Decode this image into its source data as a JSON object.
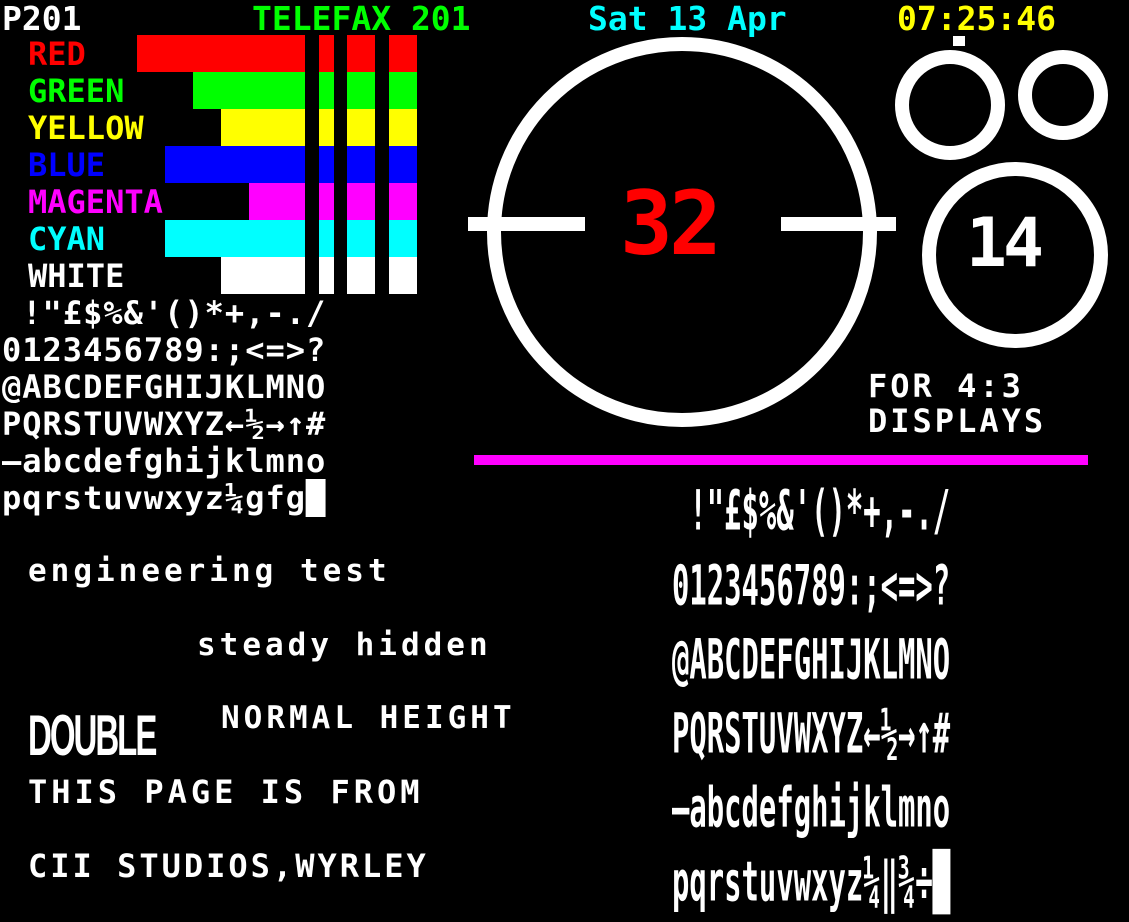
{
  "header": {
    "page_number": "P201",
    "service_name": "TELEFAX 201",
    "date": "Sat 13 Apr",
    "time": "07:25:46"
  },
  "color_bars": [
    {
      "label": "RED",
      "color": "#ff0000"
    },
    {
      "label": "GREEN",
      "color": "#00ff00"
    },
    {
      "label": "YELLOW",
      "color": "#ffff00"
    },
    {
      "label": "BLUE",
      "color": "#0000ff"
    },
    {
      "label": "MAGENTA",
      "color": "#ff00ff"
    },
    {
      "label": "CYAN",
      "color": "#00ffff"
    },
    {
      "label": "WHITE",
      "color": "#ffffff"
    }
  ],
  "charset_small": [
    " !\"£$%&'()*+,-./",
    "0123456789:;<=>?",
    "@ABCDEFGHIJKLMNO",
    "PQRSTUVWXYZ←½→↑#",
    "–abcdefghijklmno",
    "pqrstuvwxyz¼gfg█"
  ],
  "charset_large": [
    " !\"£$%&'()*+,-./",
    "0123456789:;<=>?",
    "@ABCDEFGHIJKLMNO",
    "PQRSTUVWXYZ←½→↑#",
    "–abcdefghijklmno",
    "pqrstuvwxyz¼‖¾÷█"
  ],
  "big_circle_number": "32",
  "small_circle_number": "14",
  "aspect_note": [
    "FOR 4:3",
    "DISPLAYS"
  ],
  "texts": {
    "engineering": "engineering test",
    "steady": "steady hidden",
    "double": "DOUBLE",
    "normal": "NORMAL HEIGHT",
    "from": "THIS PAGE IS FROM",
    "studio": "CII STUDIOS,WYRLEY"
  },
  "colors": {
    "background": "#000000",
    "header_service": "#00ff00",
    "header_date": "#00ffff",
    "header_time": "#ffff00",
    "number_red": "#ff0000",
    "divider_magenta": "#ff00ff"
  }
}
